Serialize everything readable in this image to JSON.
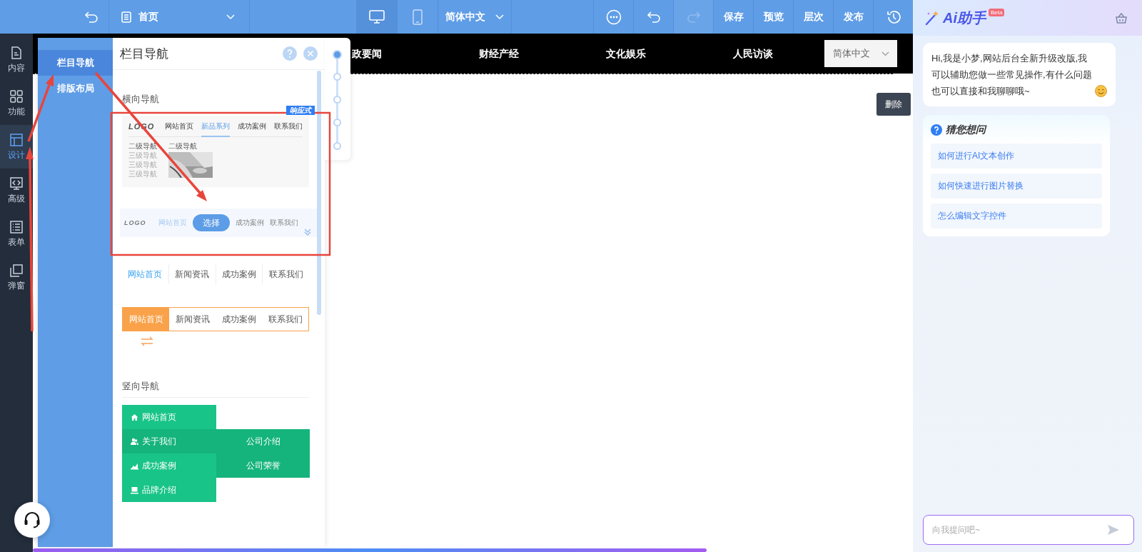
{
  "toolbar": {
    "page_select": "首页",
    "language_select": "简体中文",
    "devices": [
      {
        "kind": "desktop",
        "selected": true
      },
      {
        "kind": "mobile",
        "selected": false
      }
    ],
    "actions": [
      {
        "kind": "more",
        "disabled": false
      },
      {
        "kind": "undo",
        "disabled": false
      },
      {
        "kind": "redo",
        "disabled": true
      }
    ],
    "text_buttons": [
      "保存",
      "预览",
      "层次",
      "发布"
    ]
  },
  "sidebar": {
    "items": [
      {
        "label": "内容",
        "kind": "document",
        "selected": false
      },
      {
        "label": "功能",
        "kind": "grid",
        "selected": false
      },
      {
        "label": "设计",
        "kind": "layout",
        "selected": true
      },
      {
        "label": "高级",
        "kind": "code",
        "selected": false
      },
      {
        "label": "表单",
        "kind": "form",
        "selected": false
      },
      {
        "label": "弹窗",
        "kind": "popup",
        "selected": false
      }
    ]
  },
  "subnav": {
    "items": [
      {
        "label": "栏目导航",
        "selected": true
      },
      {
        "label": "排版布局",
        "selected": false
      }
    ]
  },
  "panel": {
    "title": "栏目导航",
    "horizontal_title": "横向导航",
    "template_1": {
      "logo": "LOGO",
      "badge": "响应式",
      "nav": [
        {
          "label": "网站首页",
          "selected": false
        },
        {
          "label": "新品系列",
          "selected": true
        },
        {
          "label": "成功案例",
          "selected": false
        },
        {
          "label": "联系我们",
          "selected": false
        }
      ],
      "submenu_titles": [
        "二级导航",
        "二级导航"
      ],
      "submenu_items": [
        "三级导航",
        "三级导航",
        "三级导航"
      ],
      "hover_bar": {
        "logo": "LOGO",
        "items": [
          {
            "label": "网站首页",
            "selected": true
          },
          {
            "label": "成功案例",
            "selected": false
          },
          {
            "label": "联系我们",
            "selected": false
          }
        ],
        "button": "选择"
      }
    },
    "template_2": {
      "nav": [
        {
          "label": "网站首页",
          "selected": true
        },
        {
          "label": "新闻资讯",
          "selected": false
        },
        {
          "label": "成功案例",
          "selected": false
        },
        {
          "label": "联系我们",
          "selected": false
        }
      ]
    },
    "template_3": {
      "nav": [
        {
          "label": "网站首页",
          "selected": true
        },
        {
          "label": "新闻资讯",
          "selected": false
        },
        {
          "label": "成功案例",
          "selected": false
        },
        {
          "label": "联系我们",
          "selected": false
        }
      ]
    },
    "vertical_title": "竖向导航",
    "vertical_menu": [
      {
        "label": "网站首页",
        "kind": "home",
        "expanded": false
      },
      {
        "label": "关于我们",
        "kind": "users",
        "expanded": true,
        "children": [
          {
            "label": "公司介绍"
          },
          {
            "label": "公司荣誉"
          }
        ]
      },
      {
        "label": "成功案例",
        "kind": "chart",
        "expanded": false
      },
      {
        "label": "品牌介绍",
        "kind": "monitor",
        "expanded": false
      }
    ]
  },
  "steps": [
    {
      "selected": true
    },
    {
      "selected": false
    },
    {
      "selected": false
    },
    {
      "selected": false
    },
    {
      "selected": false
    }
  ],
  "site_nav": {
    "items": [
      "政要闻",
      "财经产经",
      "文化娱乐",
      "人民访谈"
    ],
    "language": "简体中文"
  },
  "tooltip": "删除",
  "assistant": {
    "title": "Ai助手",
    "badge": "Beta",
    "message": "Hi,我是小梦,网站后台全新升级改版,我可以辅助您做一些常见操作,有什么问题也可以直接和我聊聊哦~",
    "suggest_title": "猜您想问",
    "suggestions": [
      "如何进行AI文本创作",
      "如何快速进行图片替换",
      "怎么编辑文字控件"
    ],
    "input_placeholder": "向我提问吧~"
  }
}
